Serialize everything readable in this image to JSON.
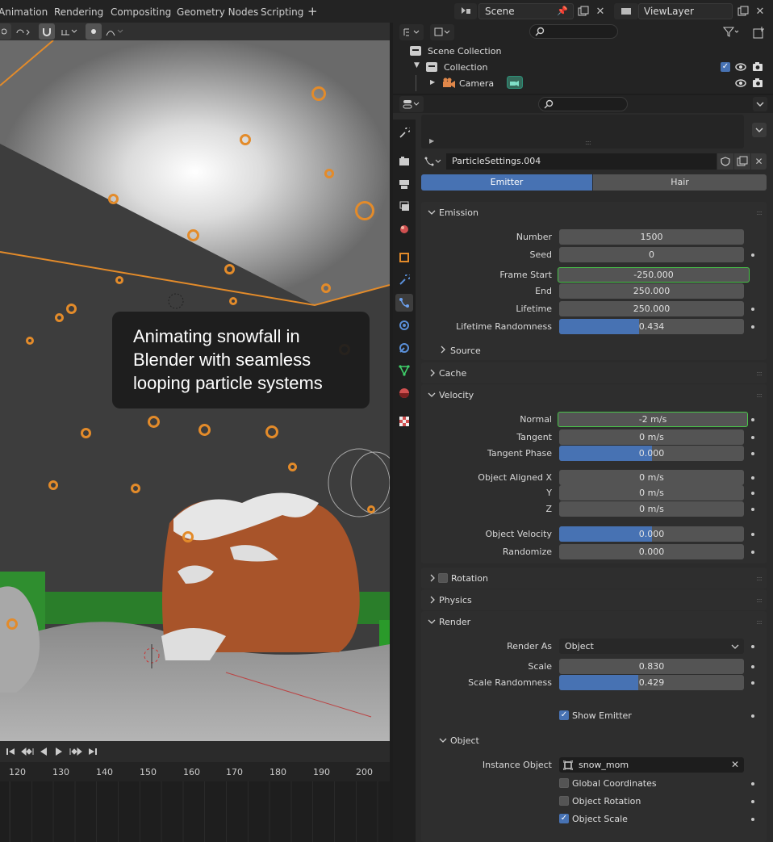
{
  "workspace_tabs": [
    "Animation",
    "Rendering",
    "Compositing",
    "Geometry Nodes",
    "Scripting"
  ],
  "add_tab_label": "+",
  "scene": {
    "name": "Scene"
  },
  "view_layer": {
    "name": "ViewLayer"
  },
  "caption": "Animating snowfall in Blender with seamless looping particle systems",
  "timeline": {
    "ticks": [
      "120",
      "130",
      "140",
      "150",
      "160",
      "170",
      "180",
      "190",
      "200"
    ]
  },
  "outliner": {
    "root": "Scene Collection",
    "collection": "Collection",
    "camera": "Camera"
  },
  "particle_settings": {
    "name": "ParticleSettings.004",
    "type_options": [
      "Emitter",
      "Hair"
    ],
    "selected_type": "Emitter"
  },
  "emission": {
    "title": "Emission",
    "number": {
      "label": "Number",
      "value": "1500"
    },
    "seed": {
      "label": "Seed",
      "value": "0"
    },
    "frame_start": {
      "label": "Frame Start",
      "value": "-250.000"
    },
    "end": {
      "label": "End",
      "value": "250.000"
    },
    "lifetime": {
      "label": "Lifetime",
      "value": "250.000"
    },
    "lifetime_random": {
      "label": "Lifetime Randomness",
      "value": "0.434",
      "fraction": 0.434
    },
    "source": "Source"
  },
  "cache": {
    "title": "Cache"
  },
  "velocity": {
    "title": "Velocity",
    "normal": {
      "label": "Normal",
      "value": "-2 m/s"
    },
    "tangent": {
      "label": "Tangent",
      "value": "0 m/s"
    },
    "tangent_phase": {
      "label": "Tangent Phase",
      "value": "0.000",
      "fraction": 0.5
    },
    "obj_x": {
      "label": "Object Aligned X",
      "value": "0 m/s"
    },
    "obj_y": {
      "label": "Y",
      "value": "0 m/s"
    },
    "obj_z": {
      "label": "Z",
      "value": "0 m/s"
    },
    "obj_velocity": {
      "label": "Object Velocity",
      "value": "0.000",
      "fraction": 0.5
    },
    "randomize": {
      "label": "Randomize",
      "value": "0.000"
    }
  },
  "rotation": {
    "title": "Rotation"
  },
  "physics": {
    "title": "Physics"
  },
  "render": {
    "title": "Render",
    "render_as": {
      "label": "Render As",
      "value": "Object"
    },
    "scale": {
      "label": "Scale",
      "value": "0.830"
    },
    "scale_random": {
      "label": "Scale Randomness",
      "value": "0.429",
      "fraction": 0.429
    },
    "show_emitter": "Show Emitter",
    "object_sub": "Object",
    "instance_object": {
      "label": "Instance Object",
      "value": "snow_mom"
    },
    "global_coords": "Global Coordinates",
    "object_rotation": "Object Rotation",
    "object_scale": "Object Scale"
  },
  "colors": {
    "accent": "#4772b3",
    "highlight": "#49c44a",
    "selection": "#e38b2a"
  }
}
